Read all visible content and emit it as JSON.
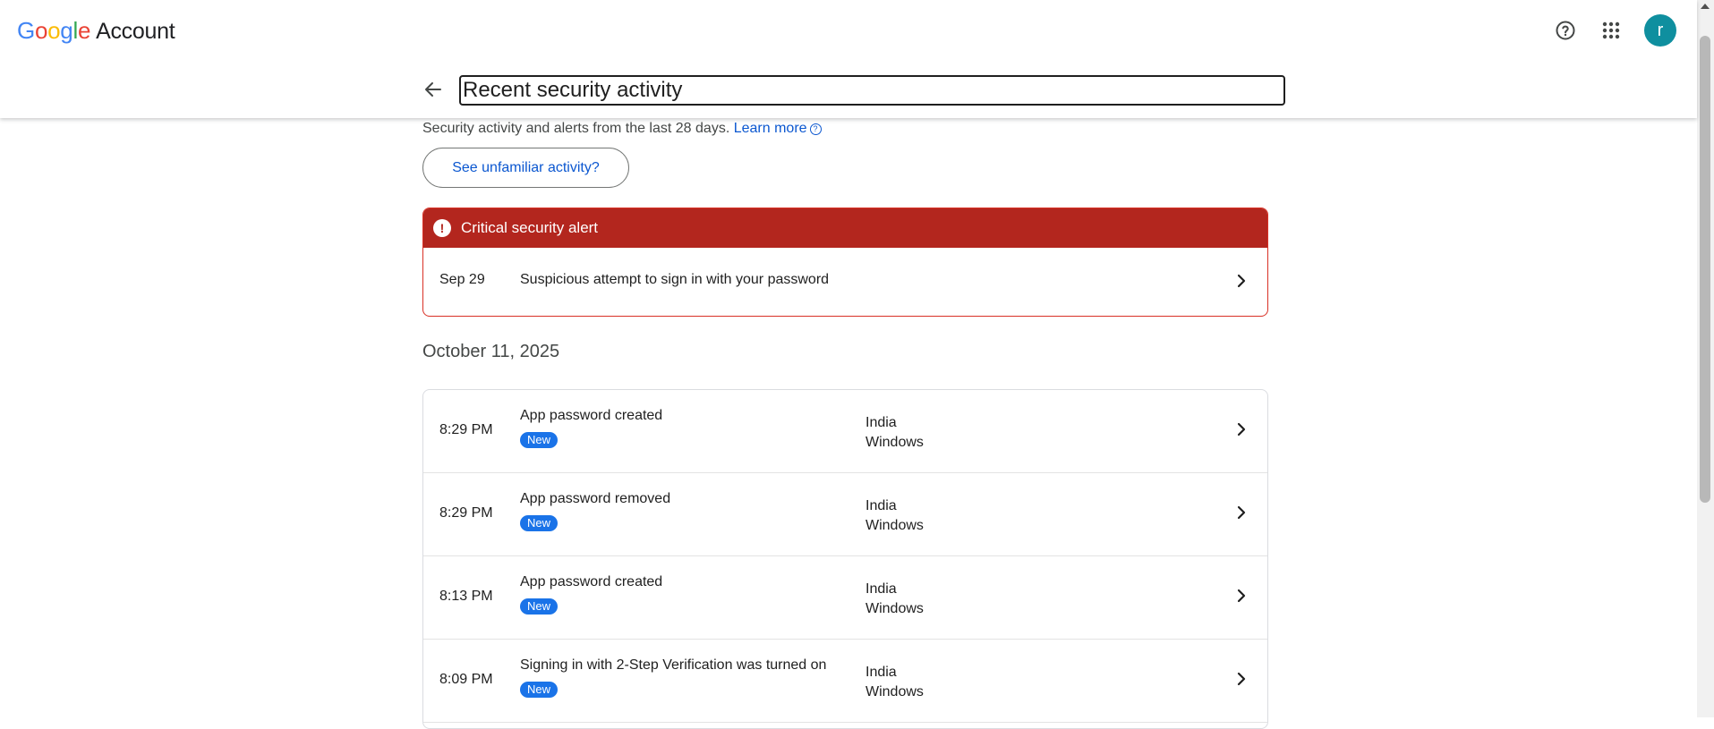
{
  "header": {
    "brand": {
      "letters": [
        "G",
        "o",
        "o",
        "g",
        "l",
        "e"
      ],
      "product": "Account",
      "colors": [
        "#4285f4",
        "#ea4335",
        "#fbbc05",
        "#4285f4",
        "#34a853",
        "#ea4335"
      ]
    },
    "help_icon": "help-circle-icon",
    "apps_icon": "apps-grid-icon",
    "avatar_letter": "r",
    "avatar_color": "#0f8f9f",
    "back_icon": "arrow-back-icon",
    "page_title": "Recent security activity"
  },
  "intro": {
    "text": "Security activity and alerts from the last 28 days.",
    "learn_more": "Learn more",
    "learn_more_icon": "help-circle-icon",
    "unfamiliar_button": "See unfamiliar activity?"
  },
  "alert": {
    "header": "Critical security alert",
    "header_color": "#b3261e",
    "icon": "alert-icon",
    "item": {
      "date": "Sep 29",
      "title": "Suspicious attempt to sign in with your password"
    }
  },
  "activity": {
    "section_date": "October 11, 2025",
    "events": [
      {
        "time": "8:29 PM",
        "title": "App password created",
        "badge": "New",
        "location": "India",
        "device": "Windows"
      },
      {
        "time": "8:29 PM",
        "title": "App password removed",
        "badge": "New",
        "location": "India",
        "device": "Windows"
      },
      {
        "time": "8:13 PM",
        "title": "App password created",
        "badge": "New",
        "location": "India",
        "device": "Windows"
      },
      {
        "time": "8:09 PM",
        "title": "Signing in with 2-Step Verification was turned on",
        "badge": "New",
        "location": "India",
        "device": "Windows"
      }
    ],
    "badge_color": "#1a73e8",
    "link_color": "#0b57d0"
  }
}
